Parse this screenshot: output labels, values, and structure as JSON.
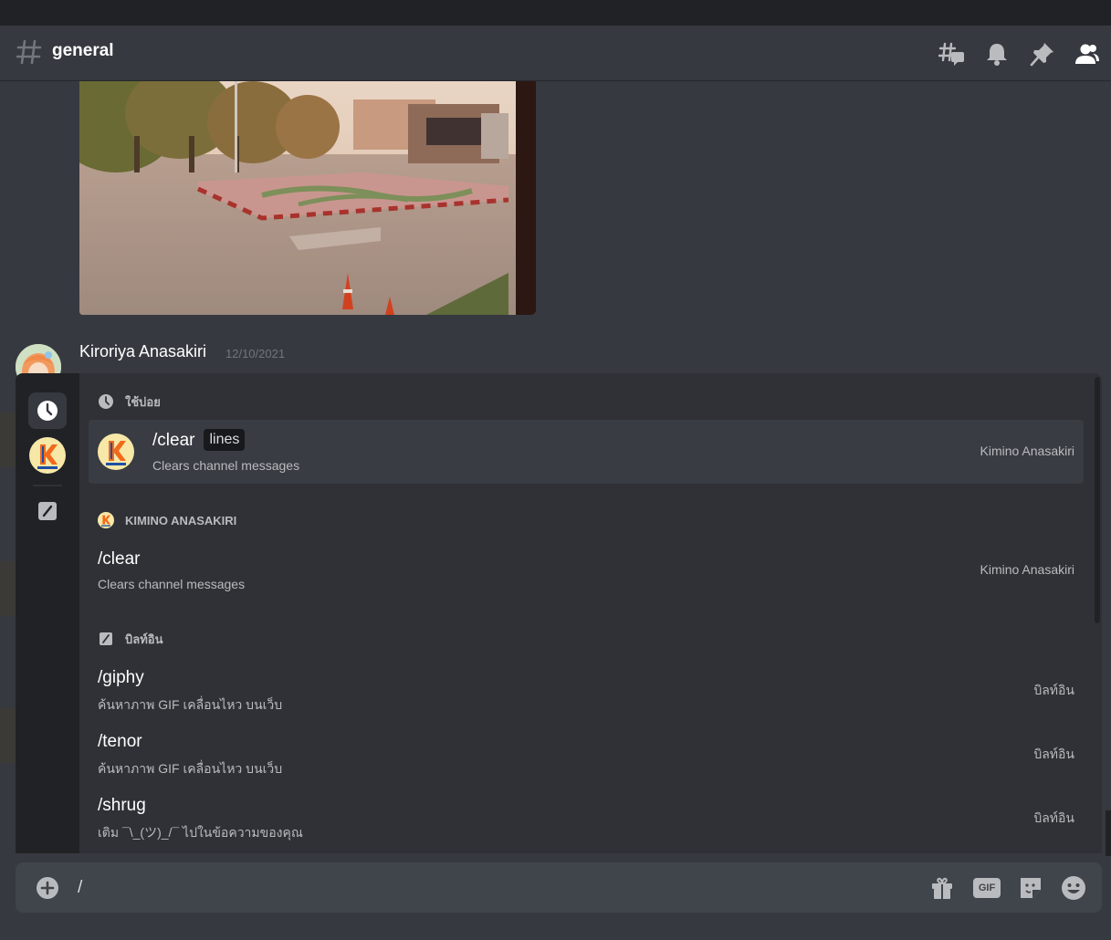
{
  "header": {
    "channel_name": "general"
  },
  "message": {
    "author": "Kiroriya Anasakiri",
    "timestamp": "12/10/2021"
  },
  "autocomplete": {
    "recent_section": {
      "title": "ใช้บ่อย",
      "items": [
        {
          "command": "/clear",
          "option": "lines",
          "description": "Clears channel messages",
          "source": "Kimino Anasakiri"
        }
      ]
    },
    "bot_section": {
      "title": "KIMINO ANASAKIRI",
      "items": [
        {
          "command": "/clear",
          "description": "Clears channel messages",
          "source": "Kimino Anasakiri"
        }
      ]
    },
    "builtin_section": {
      "title": "บิลท์อิน",
      "items": [
        {
          "command": "/giphy",
          "description": "ค้นหาภาพ GIF เคลื่อนไหว บนเว็บ",
          "source": "บิลท์อิน"
        },
        {
          "command": "/tenor",
          "description": "ค้นหาภาพ GIF เคลื่อนไหว บนเว็บ",
          "source": "บิลท์อิน"
        },
        {
          "command": "/shrug",
          "description": "เติม ¯\\_(ツ)_/¯ ไปในข้อความของคุณ",
          "source": "บิลท์อิน"
        }
      ]
    }
  },
  "composer": {
    "value": "/",
    "gif_label": "GIF"
  },
  "colors": {
    "background": "#36393f",
    "popup": "#2f3136",
    "rail": "#202225",
    "selected_row": "#393c43",
    "composer": "#40444b",
    "icon_gray": "#b9bbbe",
    "bot_badge": "#f7e8a8",
    "bot_k_orange": "#f26a1b",
    "bot_k_blue": "#1f4fa3"
  }
}
